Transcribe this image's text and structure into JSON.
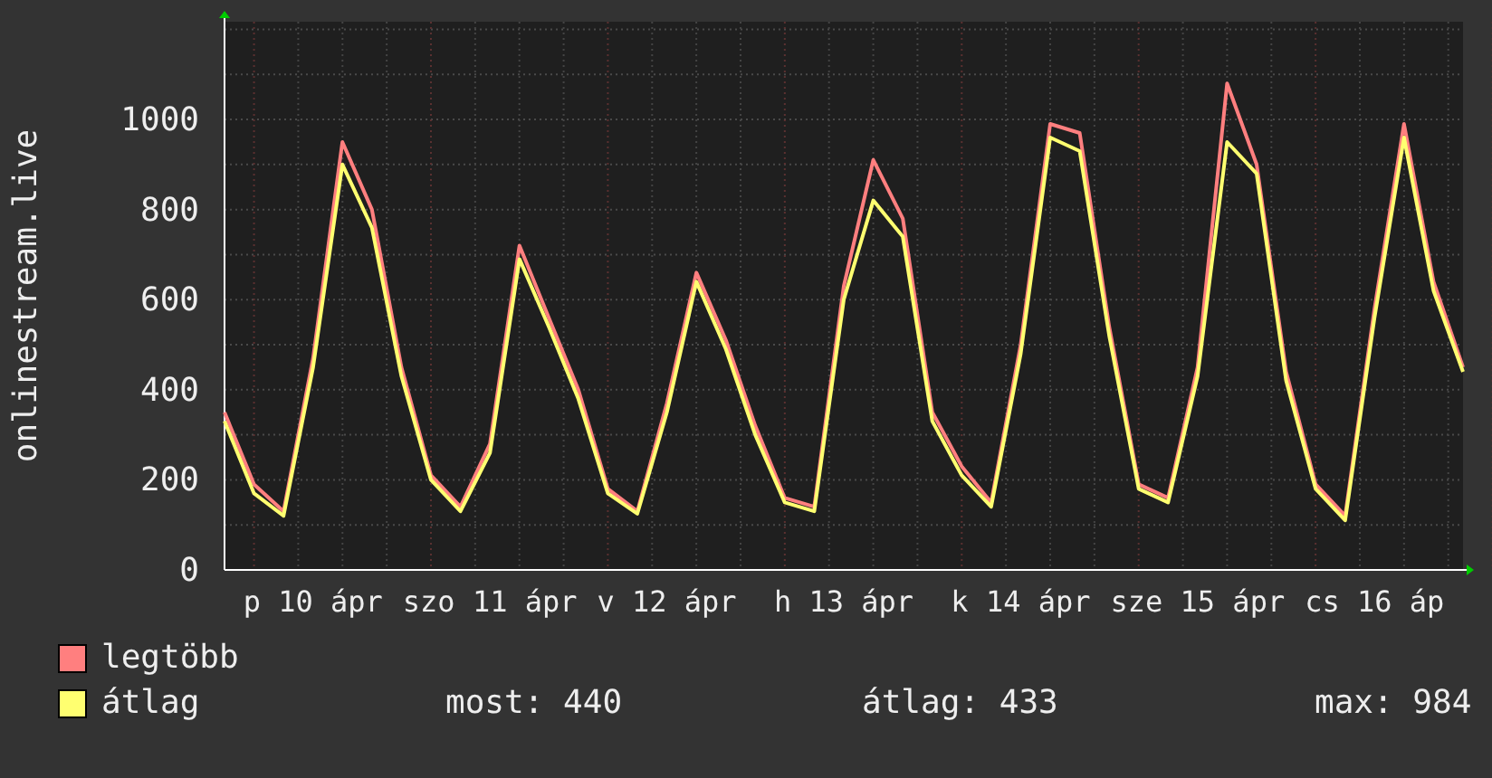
{
  "chart_data": {
    "type": "line",
    "grid": true,
    "ylabel": "onlinestream.live",
    "categories": [
      null,
      null,
      null,
      "p 10 ápr",
      null,
      null,
      null,
      null,
      null,
      "szo 11 ápr",
      null,
      null,
      null,
      null,
      null,
      "v 12 ápr",
      null,
      null,
      null,
      null,
      null,
      "h 13 ápr",
      null,
      null,
      null,
      null,
      null,
      "k 14 ápr",
      null,
      null,
      null,
      null,
      null,
      "sze 15 ápr",
      null,
      null,
      null,
      null,
      null,
      "cs 16 áp",
      null,
      null,
      null
    ],
    "ylim": [
      0,
      1217
    ],
    "yticks": [
      0,
      200,
      400,
      600,
      800,
      1000
    ],
    "series": [
      {
        "name": "legtöbb",
        "color": "#ff7f7f",
        "values": [
          350,
          190,
          130,
          470,
          950,
          800,
          450,
          210,
          140,
          280,
          720,
          560,
          400,
          180,
          130,
          370,
          660,
          510,
          320,
          160,
          140,
          630,
          910,
          780,
          350,
          230,
          150,
          500,
          990,
          970,
          540,
          190,
          160,
          450,
          1080,
          900,
          440,
          190,
          120,
          580,
          990,
          640,
          450
        ]
      },
      {
        "name": "átlag",
        "color": "#ffff70",
        "values": [
          330,
          170,
          120,
          450,
          900,
          760,
          430,
          200,
          130,
          260,
          690,
          540,
          380,
          170,
          125,
          350,
          640,
          490,
          300,
          150,
          130,
          600,
          820,
          740,
          330,
          210,
          140,
          480,
          960,
          930,
          520,
          180,
          150,
          430,
          950,
          880,
          420,
          180,
          110,
          560,
          960,
          620,
          440
        ]
      }
    ]
  },
  "legend_stats": [
    "most: 440",
    "átlag: 433",
    "max: 984"
  ]
}
